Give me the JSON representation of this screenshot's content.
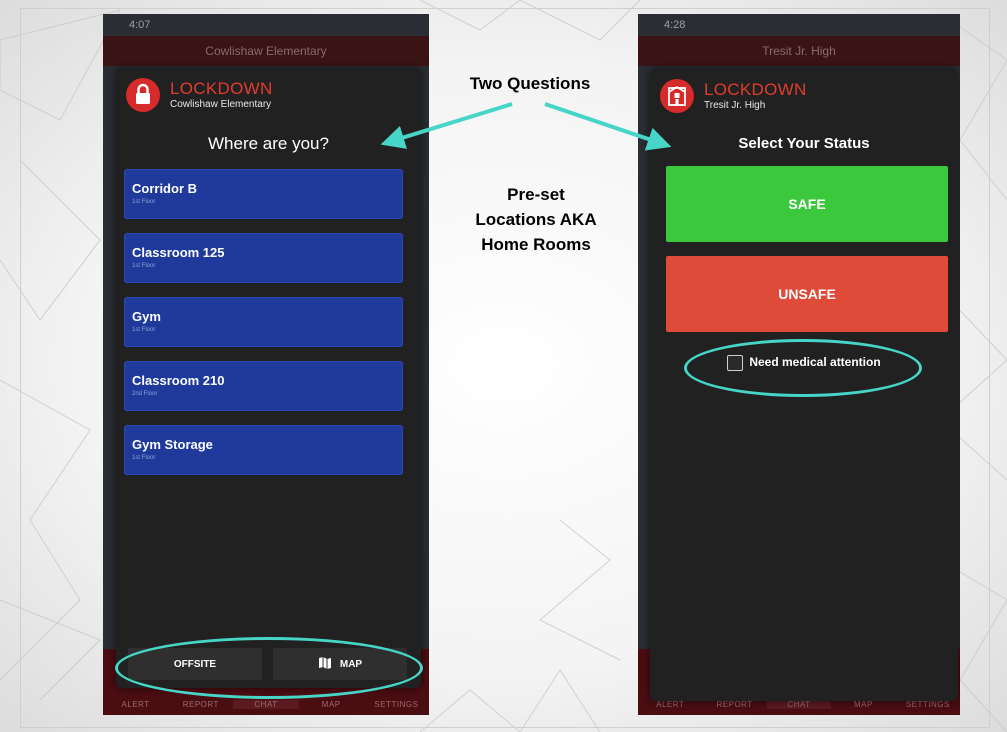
{
  "annotations": {
    "top": "Two Questions",
    "middle_lines": [
      "Pre-set",
      "Locations AKA",
      "Home Rooms"
    ]
  },
  "left_phone": {
    "time": "4:07",
    "nav_title": "Cowlishaw Elementary",
    "alert_title": "LOCKDOWN",
    "alert_subtitle": "Cowlishaw Elementary",
    "question": "Where are you?",
    "locations": [
      {
        "name": "Corridor B",
        "floor": "1st Floor"
      },
      {
        "name": "Classroom 125",
        "floor": "1st Floor"
      },
      {
        "name": "Gym",
        "floor": "1st Floor"
      },
      {
        "name": "Classroom 210",
        "floor": "2nd Floor"
      },
      {
        "name": "Gym Storage",
        "floor": "1st Floor"
      }
    ],
    "offsite_label": "OFFSITE",
    "map_label": "MAP",
    "tabs": [
      "ALERT",
      "REPORT",
      "CHAT",
      "MAP",
      "SETTINGS"
    ]
  },
  "right_phone": {
    "time": "4:28",
    "nav_title": "Tresit Jr. High",
    "alert_title": "LOCKDOWN",
    "alert_subtitle": "Tresit Jr. High",
    "question": "Select Your Status",
    "safe_label": "SAFE",
    "unsafe_label": "UNSAFE",
    "medical_label": "Need medical attention",
    "tabs": [
      "ALERT",
      "REPORT",
      "CHAT",
      "MAP",
      "SETTINGS"
    ]
  },
  "colors": {
    "accent_teal": "#46d5c7",
    "lockdown_red": "#e23b2f",
    "location_blue": "#1f3a9a",
    "safe_green": "#3cc83c",
    "unsafe_red": "#e04a38"
  },
  "icons": {
    "lock": "lock-icon",
    "school": "school-icon",
    "map": "map-icon",
    "checkbox": "checkbox-icon"
  }
}
